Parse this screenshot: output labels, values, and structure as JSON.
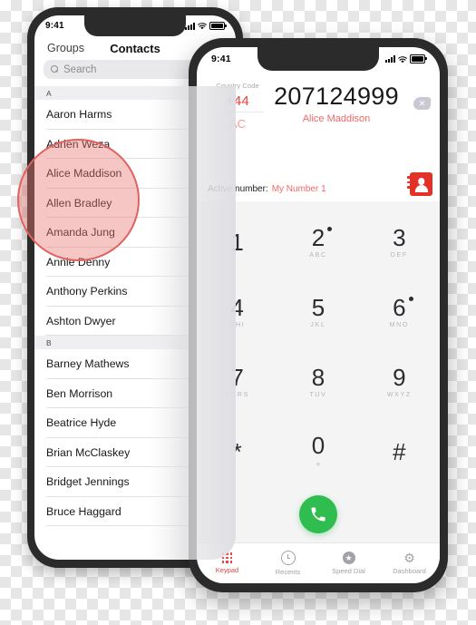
{
  "background": {
    "type": "transparency-checkerboard",
    "light": "#ffffff",
    "dark": "#e6e6e6"
  },
  "contacts_phone": {
    "status_bar": {
      "time": "9:41",
      "signal_icon": "cellular-bars-icon",
      "wifi_icon": "wifi-icon",
      "battery_icon": "battery-icon"
    },
    "nav": {
      "left_label": "Groups",
      "title": "Contacts"
    },
    "search": {
      "placeholder": "Search",
      "icon": "search-icon"
    },
    "sections": [
      {
        "letter": "A",
        "names": [
          "Aaron Harms",
          "Adrien Weza",
          "Alice Maddison",
          "Allen Bradley",
          "Amanda Jung",
          "Annie Denny",
          "Anthony Perkins",
          "Ashton Dwyer"
        ]
      },
      {
        "letter": "B",
        "names": [
          "Barney Mathews",
          "Ben Morrison",
          "Beatrice Hyde",
          "Brian McClaskey",
          "Bridget Jennings",
          "Bruce Haggard"
        ]
      }
    ],
    "highlight": {
      "shape": "circle",
      "fill": "#e97873",
      "border": "#e0635f",
      "targets": [
        "Adrien Weza",
        "Alice Maddison",
        "Allen Bradley"
      ]
    }
  },
  "dialer_phone": {
    "status_bar": {
      "time": "9:41",
      "signal_icon": "cellular-bars-icon",
      "wifi_icon": "wifi-icon",
      "battery_icon": "battery-icon"
    },
    "country_code": {
      "label": "Country Code",
      "value": "+44",
      "clear_label": "AC"
    },
    "entry": {
      "number": "207124999",
      "matched_contact": "Alice Maddison",
      "delete_icon": "backspace-delete-icon"
    },
    "active_number": {
      "label": "Active number:",
      "value": "My Number 1"
    },
    "contacts_book_icon": "address-book-icon",
    "keypad": {
      "keys": [
        {
          "digit": "1",
          "letters": "",
          "badge": false
        },
        {
          "digit": "2",
          "letters": "ABC",
          "badge": true
        },
        {
          "digit": "3",
          "letters": "DEF",
          "badge": false
        },
        {
          "digit": "4",
          "letters": "GHI",
          "badge": false
        },
        {
          "digit": "5",
          "letters": "JKL",
          "badge": false
        },
        {
          "digit": "6",
          "letters": "MNO",
          "badge": true
        },
        {
          "digit": "7",
          "letters": "PQRS",
          "badge": false
        },
        {
          "digit": "8",
          "letters": "TUV",
          "badge": false
        },
        {
          "digit": "9",
          "letters": "WXYZ",
          "badge": false
        },
        {
          "digit": "*",
          "letters": "",
          "badge": false
        },
        {
          "digit": "0",
          "letters": "+",
          "badge": false
        },
        {
          "digit": "#",
          "letters": "",
          "badge": false
        }
      ],
      "call_button": {
        "icon": "phone-handset-icon",
        "color": "#2ebd4e"
      }
    },
    "tabs": [
      {
        "label": "Keypad",
        "icon": "keypad-icon",
        "active": true
      },
      {
        "label": "Recents",
        "icon": "clock-icon",
        "active": false
      },
      {
        "label": "Speed Dial",
        "icon": "star-circle-icon",
        "active": false
      },
      {
        "label": "Dashboard",
        "icon": "gear-icon",
        "active": false
      }
    ],
    "accent_color": "#e8413c"
  }
}
